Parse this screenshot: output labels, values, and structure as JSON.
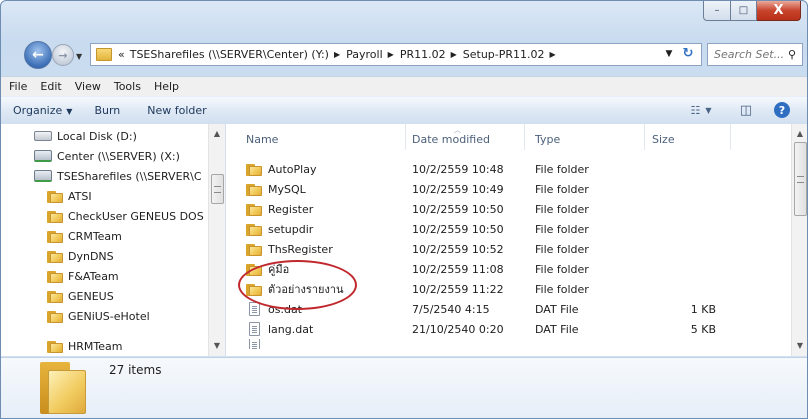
{
  "window": {
    "minimize_glyph": "–",
    "maximize_glyph": "□",
    "close_glyph": "X"
  },
  "nav": {
    "back_glyph": "←",
    "forward_glyph": "→",
    "history_glyph": "▼",
    "breadcrumb_lead": "«",
    "breadcrumbs": [
      "TSESharefiles (\\\\SERVER\\Center) (Y:)",
      "Payroll",
      "PR11.02",
      "Setup-PR11.02"
    ],
    "crumb_sep": "▶",
    "address_drop": "▼",
    "refresh_glyph": "↻",
    "search_placeholder": "Search Set...",
    "search_glyph": "⚲"
  },
  "menu": [
    "File",
    "Edit",
    "View",
    "Tools",
    "Help"
  ],
  "toolbar": {
    "organize": "Organize",
    "organize_caret": "▼",
    "burn": "Burn",
    "new_folder": "New folder",
    "views_glyph": "☷",
    "views_caret": "▼",
    "preview_glyph": "◫",
    "help_glyph": "?"
  },
  "nav_pane": {
    "items": [
      {
        "label": "Local Disk (D:)",
        "icon": "drive-icon"
      },
      {
        "label": "Center (\\\\SERVER) (X:)",
        "icon": "network-drive-icon"
      },
      {
        "label": "TSESharefiles (\\\\SERVER\\C",
        "icon": "network-drive-icon"
      },
      {
        "label": "ATSI",
        "icon": "folder-icon"
      },
      {
        "label": "CheckUser GENEUS DOS",
        "icon": "folder-icon"
      },
      {
        "label": "CRMTeam",
        "icon": "folder-icon"
      },
      {
        "label": "DynDNS",
        "icon": "folder-icon"
      },
      {
        "label": "F&ATeam",
        "icon": "folder-icon"
      },
      {
        "label": "GENEUS",
        "icon": "folder-icon"
      },
      {
        "label": "GENiUS-eHotel",
        "icon": "folder-icon"
      },
      {
        "label": "HRMTeam",
        "icon": "folder-icon"
      }
    ],
    "scroll_up": "▲",
    "scroll_down": "▼"
  },
  "file_list": {
    "columns": [
      "Name",
      "Date modified",
      "Type",
      "Size"
    ],
    "sort_glyph": "︿",
    "rows": [
      {
        "name": "AutoPlay",
        "date": "10/2/2559 10:48",
        "type": "File folder",
        "size": "",
        "icon": "folder-icon"
      },
      {
        "name": "MySQL",
        "date": "10/2/2559 10:49",
        "type": "File folder",
        "size": "",
        "icon": "folder-icon"
      },
      {
        "name": "Register",
        "date": "10/2/2559 10:50",
        "type": "File folder",
        "size": "",
        "icon": "folder-icon"
      },
      {
        "name": "setupdir",
        "date": "10/2/2559 10:50",
        "type": "File folder",
        "size": "",
        "icon": "folder-icon"
      },
      {
        "name": "ThsRegister",
        "date": "10/2/2559 10:52",
        "type": "File folder",
        "size": "",
        "icon": "folder-icon"
      },
      {
        "name": "คู่มือ",
        "date": "10/2/2559 11:08",
        "type": "File folder",
        "size": "",
        "icon": "folder-icon"
      },
      {
        "name": "ตัวอย่างรายงาน",
        "date": "10/2/2559 11:22",
        "type": "File folder",
        "size": "",
        "icon": "folder-icon"
      },
      {
        "name": "os.dat",
        "date": "7/5/2540 4:15",
        "type": "DAT File",
        "size": "1 KB",
        "icon": "file-icon"
      },
      {
        "name": "lang.dat",
        "date": "21/10/2540 0:20",
        "type": "DAT File",
        "size": "5 KB",
        "icon": "file-icon"
      }
    ],
    "scroll_up": "▲",
    "scroll_down": "▼"
  },
  "details": {
    "item_count": "27 items"
  },
  "colors": {
    "highlight_circle": "#c0282d",
    "toolbar_text": "#1e395b"
  }
}
